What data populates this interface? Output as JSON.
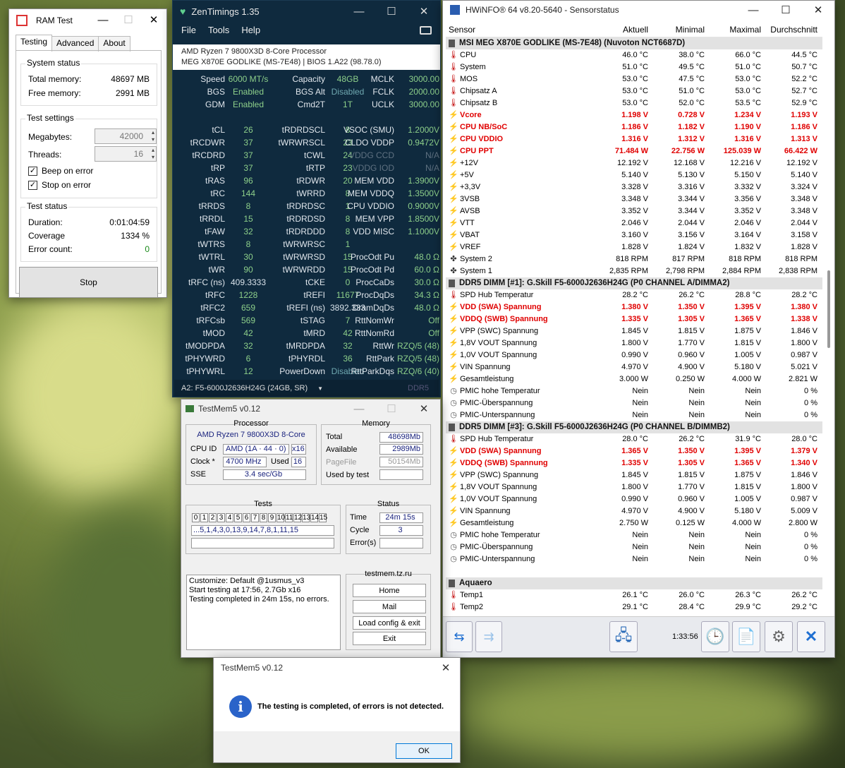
{
  "ramtest": {
    "title": "RAM Test",
    "tabs": [
      "Testing",
      "Advanced",
      "About"
    ],
    "system_status": {
      "label": "System status",
      "total_label": "Total memory:",
      "total": "48697 MB",
      "free_label": "Free memory:",
      "free": "2991 MB"
    },
    "test_settings": {
      "label": "Test settings",
      "mb_label": "Megabytes:",
      "mb": "42000",
      "threads_label": "Threads:",
      "threads": "16",
      "beep": "Beep on error",
      "stop": "Stop on error"
    },
    "test_status": {
      "label": "Test status",
      "duration_label": "Duration:",
      "duration": "0:01:04:59",
      "coverage_label": "Coverage",
      "coverage": "1334 %",
      "errors_label": "Error count:",
      "errors": "0"
    },
    "stop_button": "Stop"
  },
  "zen": {
    "title": "ZenTimings 1.35",
    "menu": [
      "File",
      "Tools",
      "Help"
    ],
    "cpu": "AMD Ryzen 7 9800X3D 8-Core Processor",
    "board": "MEG X870E GODLIKE (MS-7E48) | BIOS 1.A22 (98.78.0)",
    "col1": [
      [
        "Speed",
        "6000 MT/s"
      ],
      [
        "BGS",
        "Enabled"
      ],
      [
        "GDM",
        "Enabled"
      ],
      [
        "",
        ""
      ],
      [
        "tCL",
        "26"
      ],
      [
        "tRCDWR",
        "37"
      ],
      [
        "tRCDRD",
        "37"
      ],
      [
        "tRP",
        "37"
      ],
      [
        "tRAS",
        "96"
      ],
      [
        "tRC",
        "144"
      ],
      [
        "tRRDS",
        "8"
      ],
      [
        "tRRDL",
        "15"
      ],
      [
        "tFAW",
        "32"
      ],
      [
        "tWTRS",
        "8"
      ],
      [
        "tWTRL",
        "30"
      ],
      [
        "tWR",
        "90"
      ],
      [
        "tRFC (ns)",
        "409.3333"
      ],
      [
        "tRFC",
        "1228"
      ],
      [
        "tRFC2",
        "659"
      ],
      [
        "tRFCsb",
        "569"
      ],
      [
        "tMOD",
        "42"
      ],
      [
        "tMODPDA",
        "32"
      ],
      [
        "tPHYWRD",
        "6"
      ],
      [
        "tPHYWRL",
        "12"
      ]
    ],
    "col2": [
      [
        "Capacity",
        "48GB"
      ],
      [
        "BGS Alt",
        "Disabled"
      ],
      [
        "Cmd2T",
        "1T"
      ],
      [
        "",
        ""
      ],
      [
        "tRDRDSCL",
        "8"
      ],
      [
        "tWRWRSCL",
        "23"
      ],
      [
        "tCWL",
        "24"
      ],
      [
        "tRTP",
        "23"
      ],
      [
        "tRDWR",
        "20"
      ],
      [
        "tWRRD",
        "8"
      ],
      [
        "tRDRDSC",
        "1"
      ],
      [
        "tRDRDSD",
        "8"
      ],
      [
        "tRDRDDD",
        "8"
      ],
      [
        "tWRWRSC",
        "1"
      ],
      [
        "tWRWRSD",
        "15"
      ],
      [
        "tWRWRDD",
        "15"
      ],
      [
        "tCKE",
        "0"
      ],
      [
        "tREFI",
        "11677"
      ],
      [
        "tREFI (ns)",
        "3892.333"
      ],
      [
        "tSTAG",
        "7"
      ],
      [
        "tMRD",
        "42"
      ],
      [
        "tMRDPDA",
        "32"
      ],
      [
        "tPHYRDL",
        "36"
      ],
      [
        "PowerDown",
        "Disabled"
      ]
    ],
    "col3": [
      [
        "MCLK",
        "3000.00"
      ],
      [
        "FCLK",
        "2000.00"
      ],
      [
        "UCLK",
        "3000.00"
      ],
      [
        "",
        ""
      ],
      [
        "VSOC (SMU)",
        "1.2000V"
      ],
      [
        "CLDO VDDP",
        "0.9472V"
      ],
      [
        "VDDG CCD",
        "N/A"
      ],
      [
        "VDDG IOD",
        "N/A"
      ],
      [
        "MEM VDD",
        "1.3900V"
      ],
      [
        "MEM VDDQ",
        "1.3500V"
      ],
      [
        "CPU VDDIO",
        "0.9000V"
      ],
      [
        "MEM VPP",
        "1.8500V"
      ],
      [
        "VDD MISC",
        "1.1000V"
      ],
      [
        "",
        ""
      ],
      [
        "ProcOdt Pu",
        "48.0 Ω"
      ],
      [
        "ProcOdt Pd",
        "60.0 Ω"
      ],
      [
        "ProcCaDs",
        "30.0 Ω"
      ],
      [
        "ProcDqDs",
        "34.3 Ω"
      ],
      [
        "DramDqDs",
        "48.0 Ω"
      ],
      [
        "RttNomWr",
        "Off"
      ],
      [
        "RttNomRd",
        "Off"
      ],
      [
        "RttWr",
        "RZQ/5 (48)"
      ],
      [
        "RttPark",
        "RZQ/5 (48)"
      ],
      [
        "RttParkDqs",
        "RZQ/6 (40)"
      ]
    ],
    "module": "A2: F5-6000J2636H24G (24GB, SR)",
    "ddr": "DDR5"
  },
  "hw": {
    "title": "HWiNFO® 64 v8.20-5640 - Sensorstatus",
    "headers": [
      "Sensor",
      "Aktuell",
      "Minimal",
      "Maximal",
      "Durchschnitt"
    ],
    "rows": [
      {
        "t": "h",
        "n": "MSI MEG X870E GODLIKE (MS-7E48) (Nuvoton NCT6687D)"
      },
      {
        "i": "tmp",
        "n": "CPU",
        "v": [
          "46.0 °C",
          "38.0 °C",
          "66.0 °C",
          "44.5 °C"
        ]
      },
      {
        "i": "tmp",
        "n": "System",
        "v": [
          "51.0 °C",
          "49.5 °C",
          "51.0 °C",
          "50.7 °C"
        ]
      },
      {
        "i": "tmp",
        "n": "MOS",
        "v": [
          "53.0 °C",
          "47.5 °C",
          "53.0 °C",
          "52.2 °C"
        ]
      },
      {
        "i": "tmp",
        "n": "Chipsatz A",
        "v": [
          "53.0 °C",
          "51.0 °C",
          "53.0 °C",
          "52.7 °C"
        ]
      },
      {
        "i": "tmp",
        "n": "Chipsatz B",
        "v": [
          "53.0 °C",
          "52.0 °C",
          "53.5 °C",
          "52.9 °C"
        ]
      },
      {
        "i": "vol",
        "n": "Vcore",
        "r": 1,
        "v": [
          "1.198 V",
          "0.728 V",
          "1.234 V",
          "1.193 V"
        ]
      },
      {
        "i": "vol",
        "n": "CPU NB/SoC",
        "r": 1,
        "v": [
          "1.186 V",
          "1.182 V",
          "1.190 V",
          "1.186 V"
        ]
      },
      {
        "i": "vol",
        "n": "CPU VDDIO",
        "r": 1,
        "v": [
          "1.316 V",
          "1.312 V",
          "1.316 V",
          "1.313 V"
        ]
      },
      {
        "i": "vol",
        "n": "CPU PPT",
        "r": 1,
        "v": [
          "71.484 W",
          "22.756 W",
          "125.039 W",
          "66.422 W"
        ]
      },
      {
        "i": "vol",
        "n": "+12V",
        "v": [
          "12.192 V",
          "12.168 V",
          "12.216 V",
          "12.192 V"
        ]
      },
      {
        "i": "vol",
        "n": "+5V",
        "v": [
          "5.140 V",
          "5.130 V",
          "5.150 V",
          "5.140 V"
        ]
      },
      {
        "i": "vol",
        "n": "+3,3V",
        "v": [
          "3.328 V",
          "3.316 V",
          "3.332 V",
          "3.324 V"
        ]
      },
      {
        "i": "vol",
        "n": "3VSB",
        "v": [
          "3.348 V",
          "3.344 V",
          "3.356 V",
          "3.348 V"
        ]
      },
      {
        "i": "vol",
        "n": "AVSB",
        "v": [
          "3.352 V",
          "3.344 V",
          "3.352 V",
          "3.348 V"
        ]
      },
      {
        "i": "vol",
        "n": "VTT",
        "v": [
          "2.046 V",
          "2.044 V",
          "2.046 V",
          "2.044 V"
        ]
      },
      {
        "i": "vol",
        "n": "VBAT",
        "v": [
          "3.160 V",
          "3.156 V",
          "3.164 V",
          "3.158 V"
        ]
      },
      {
        "i": "vol",
        "n": "VREF",
        "v": [
          "1.828 V",
          "1.824 V",
          "1.832 V",
          "1.828 V"
        ]
      },
      {
        "i": "fan",
        "n": "System 2",
        "v": [
          "818 RPM",
          "817 RPM",
          "818 RPM",
          "818 RPM"
        ]
      },
      {
        "i": "fan",
        "n": "System 1",
        "v": [
          "2,835 RPM",
          "2,798 RPM",
          "2,884 RPM",
          "2,838 RPM"
        ]
      },
      {
        "t": "h",
        "n": "DDR5 DIMM [#1]: G.Skill F5-6000J2636H24G (P0 CHANNEL A/DIMMA2)"
      },
      {
        "i": "tmp",
        "n": "SPD Hub Temperatur",
        "v": [
          "28.2 °C",
          "26.2 °C",
          "28.8 °C",
          "28.2 °C"
        ]
      },
      {
        "i": "vol",
        "n": "VDD (SWA) Spannung",
        "r": 1,
        "v": [
          "1.380 V",
          "1.350 V",
          "1.395 V",
          "1.380 V"
        ]
      },
      {
        "i": "vol",
        "n": "VDDQ (SWB) Spannung",
        "r": 1,
        "v": [
          "1.335 V",
          "1.305 V",
          "1.365 V",
          "1.338 V"
        ]
      },
      {
        "i": "vol",
        "n": "VPP (SWC) Spannung",
        "v": [
          "1.845 V",
          "1.815 V",
          "1.875 V",
          "1.846 V"
        ]
      },
      {
        "i": "vol",
        "n": "1,8V VOUT Spannung",
        "v": [
          "1.800 V",
          "1.770 V",
          "1.815 V",
          "1.800 V"
        ]
      },
      {
        "i": "vol",
        "n": "1,0V VOUT Spannung",
        "v": [
          "0.990 V",
          "0.960 V",
          "1.005 V",
          "0.987 V"
        ]
      },
      {
        "i": "vol",
        "n": "VIN Spannung",
        "v": [
          "4.970 V",
          "4.900 V",
          "5.180 V",
          "5.021 V"
        ]
      },
      {
        "i": "vol",
        "n": "Gesamtleistung",
        "v": [
          "3.000 W",
          "0.250 W",
          "4.000 W",
          "2.821 W"
        ]
      },
      {
        "i": "clk",
        "n": "PMIC hohe Temperatur",
        "v": [
          "Nein",
          "Nein",
          "Nein",
          "0 %"
        ]
      },
      {
        "i": "clk",
        "n": "PMIC-Überspannung",
        "v": [
          "Nein",
          "Nein",
          "Nein",
          "0 %"
        ]
      },
      {
        "i": "clk",
        "n": "PMIC-Unterspannung",
        "v": [
          "Nein",
          "Nein",
          "Nein",
          "0 %"
        ]
      },
      {
        "t": "h",
        "n": "DDR5 DIMM [#3]: G.Skill F5-6000J2636H24G (P0 CHANNEL B/DIMMB2)"
      },
      {
        "i": "tmp",
        "n": "SPD Hub Temperatur",
        "v": [
          "28.0 °C",
          "26.2 °C",
          "31.9 °C",
          "28.0 °C"
        ]
      },
      {
        "i": "vol",
        "n": "VDD (SWA) Spannung",
        "r": 1,
        "v": [
          "1.365 V",
          "1.350 V",
          "1.395 V",
          "1.379 V"
        ]
      },
      {
        "i": "vol",
        "n": "VDDQ (SWB) Spannung",
        "r": 1,
        "v": [
          "1.335 V",
          "1.305 V",
          "1.365 V",
          "1.340 V"
        ]
      },
      {
        "i": "vol",
        "n": "VPP (SWC) Spannung",
        "v": [
          "1.845 V",
          "1.815 V",
          "1.875 V",
          "1.846 V"
        ]
      },
      {
        "i": "vol",
        "n": "1,8V VOUT Spannung",
        "v": [
          "1.800 V",
          "1.770 V",
          "1.815 V",
          "1.800 V"
        ]
      },
      {
        "i": "vol",
        "n": "1,0V VOUT Spannung",
        "v": [
          "0.990 V",
          "0.960 V",
          "1.005 V",
          "0.987 V"
        ]
      },
      {
        "i": "vol",
        "n": "VIN Spannung",
        "v": [
          "4.970 V",
          "4.900 V",
          "5.180 V",
          "5.009 V"
        ]
      },
      {
        "i": "vol",
        "n": "Gesamtleistung",
        "v": [
          "2.750 W",
          "0.125 W",
          "4.000 W",
          "2.800 W"
        ]
      },
      {
        "i": "clk",
        "n": "PMIC hohe Temperatur",
        "v": [
          "Nein",
          "Nein",
          "Nein",
          "0 %"
        ]
      },
      {
        "i": "clk",
        "n": "PMIC-Überspannung",
        "v": [
          "Nein",
          "Nein",
          "Nein",
          "0 %"
        ]
      },
      {
        "i": "clk",
        "n": "PMIC-Unterspannung",
        "v": [
          "Nein",
          "Nein",
          "Nein",
          "0 %"
        ]
      },
      {
        "t": "b"
      },
      {
        "t": "h",
        "n": "Aquaero"
      },
      {
        "i": "tmp",
        "n": "Temp1",
        "v": [
          "26.1 °C",
          "26.0 °C",
          "26.3 °C",
          "26.2 °C"
        ]
      },
      {
        "i": "tmp",
        "n": "Temp2",
        "v": [
          "29.1 °C",
          "28.4 °C",
          "29.9 °C",
          "29.2 °C"
        ]
      }
    ],
    "timer": "1:33:56"
  },
  "tm5": {
    "title": "TestMem5 v0.12",
    "proc_label": "Processor",
    "cpu": "AMD Ryzen 7 9800X3D 8-Core",
    "cpuid_label": "CPU ID",
    "cpuid": "AMD  (1A · 44 · 0)",
    "cpuid_threads": "x16",
    "clock_label": "Clock *",
    "clock": "4700 MHz",
    "used_label": "Used",
    "used": "16",
    "sse_label": "SSE",
    "sse": "3.4 sec/Gb",
    "mem_label": "Memory",
    "total_label": "Total",
    "total": "48698Mb",
    "avail_label": "Available",
    "avail": "2989Mb",
    "pagefile_label": "PageFile",
    "pagefile": "50154Mb",
    "usedby_label": "Used by test",
    "usedby": "",
    "tests_label": "Tests",
    "test_nums": [
      "0",
      "1",
      "2",
      "3",
      "4",
      "5",
      "6",
      "7",
      "8",
      "9",
      "10",
      "11",
      "12",
      "13",
      "14",
      "15"
    ],
    "test_seq": "...5,1,4,3,0,13,9,14,7,8,1,11,15",
    "status_label": "Status",
    "time_label": "Time",
    "time": "24m 15s",
    "cycle_label": "Cycle",
    "cycle": "3",
    "errors_label": "Error(s)",
    "errors": "",
    "log": [
      "Customize: Default @1usmus_v3",
      "Start testing at 17:56, 2.7Gb x16",
      "Testing completed in 24m 15s, no errors."
    ],
    "site": "testmem.tz.ru",
    "buttons": [
      "Home",
      "Mail",
      "Load config & exit",
      "Exit"
    ]
  },
  "dlg": {
    "title": "TestMem5 v0.12",
    "message": "The testing is completed, of errors is not detected.",
    "ok": "OK"
  }
}
